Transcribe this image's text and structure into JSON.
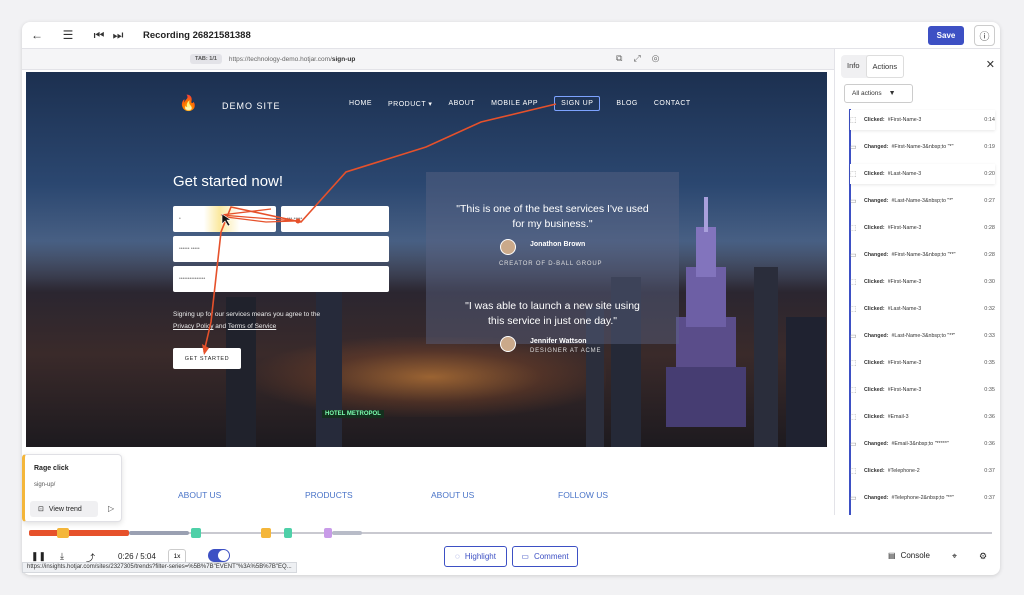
{
  "header": {
    "title": "Recording 26821581388",
    "save_label": "Save"
  },
  "urlbar": {
    "tab": "TAB: 1/1",
    "url_prefix": "https://technology-demo.hotjar.com/",
    "url_path": "sign-up"
  },
  "site": {
    "name": "DEMO SITE",
    "nav": [
      "HOME",
      "PRODUCT ▾",
      "ABOUT",
      "MOBILE APP",
      "SIGN UP",
      "BLOG",
      "CONTACT"
    ],
    "headline": "Get started now!",
    "fine_print_1": "Signing up for our services means you agree to the",
    "privacy": "Privacy Policy",
    "and": "and",
    "terms": "Terms of Service",
    "cta": "GET STARTED",
    "quote_1": "\"This is one of the best services I've used for my business.\"",
    "person_1": "Jonathon Brown",
    "role_1": "CREATOR OF D-BALL GROUP",
    "quote_2": "\"I was able to launch a new site using this service in just one day.\"",
    "person_2": "Jennifer Wattson",
    "role_2": "DESIGNER AT ACME",
    "footer_links": [
      "ABOUT US",
      "PRODUCTS",
      "ABOUT US",
      "FOLLOW US"
    ],
    "billboard": "HOTEL METROPOL"
  },
  "rage_card": {
    "title": "Rage click",
    "url": "sign-up/",
    "button": "View trend"
  },
  "panel": {
    "tabs": [
      "Info",
      "Actions"
    ],
    "active_tab": "Actions",
    "filter": "All actions",
    "actions": [
      {
        "label": "Clicked:",
        "target": "#First-Name-3",
        "time": "0:14",
        "highlight": true
      },
      {
        "label": "Changed:",
        "target": "#First-Name-3&nbsp;to \"*\"",
        "time": "0:19",
        "highlight": false
      },
      {
        "label": "Clicked:",
        "target": "#Last-Name-3",
        "time": "0:20",
        "highlight": true
      },
      {
        "label": "Changed:",
        "target": "#Last-Name-3&nbsp;to \"*\"",
        "time": "0:27",
        "highlight": false
      },
      {
        "label": "Clicked:",
        "target": "#First-Name-3",
        "time": "0:28",
        "highlight": false
      },
      {
        "label": "Changed:",
        "target": "#First-Name-3&nbsp;to \"**\"",
        "time": "0:28",
        "highlight": false
      },
      {
        "label": "Clicked:",
        "target": "#First-Name-3",
        "time": "0:30",
        "highlight": false
      },
      {
        "label": "Clicked:",
        "target": "#Last-Name-3",
        "time": "0:32",
        "highlight": false
      },
      {
        "label": "Changed:",
        "target": "#Last-Name-3&nbsp;to \"**\"",
        "time": "0:33",
        "highlight": false
      },
      {
        "label": "Clicked:",
        "target": "#First-Name-3",
        "time": "0:35",
        "highlight": false
      },
      {
        "label": "Clicked:",
        "target": "#First-Name-3",
        "time": "0:35",
        "highlight": false
      },
      {
        "label": "Clicked:",
        "target": "#Email-3",
        "time": "0:36",
        "highlight": false
      },
      {
        "label": "Changed:",
        "target": "#Email-3&nbsp;to \"*****\"",
        "time": "0:36",
        "highlight": false
      },
      {
        "label": "Clicked:",
        "target": "#Telephone-2",
        "time": "0:37",
        "highlight": false
      },
      {
        "label": "Changed:",
        "target": "#Telephone-2&nbsp;to \"**\"",
        "time": "0:37",
        "highlight": false
      }
    ]
  },
  "player": {
    "time": "0:26 / 5:04",
    "speed": "1x",
    "highlight_label": "Highlight",
    "comment_label": "Comment",
    "console_label": "Console"
  },
  "status_url": "https://insights.hotjar.com/sites/2327305/trends?filter-series=%5B%7B\"EVENT\"%3A%5B%7B\"EQ...",
  "colors": {
    "accent": "#3d50c4",
    "rage": "#f4b63a",
    "trail": "#e6512b"
  }
}
